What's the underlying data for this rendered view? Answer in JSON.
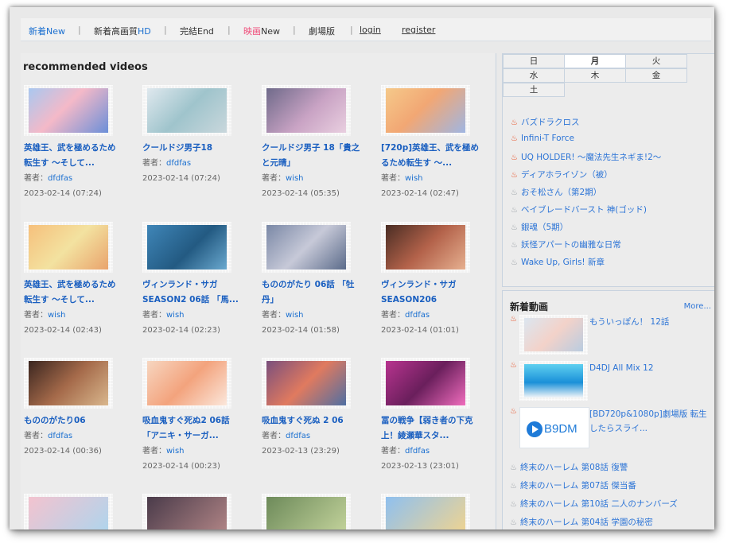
{
  "nav": {
    "items": [
      {
        "pre": "",
        "hl": "新着New",
        "post": ""
      },
      {
        "pre": "新着高画質",
        "hl": "HD",
        "post": ""
      },
      {
        "pre": "完結End",
        "hl": "",
        "post": ""
      },
      {
        "pre": "",
        "hl": "映画",
        "post": "New"
      },
      {
        "pre": "劇場版",
        "hl": "",
        "post": ""
      }
    ],
    "login": "login",
    "register": "register",
    "separator": "|"
  },
  "main": {
    "title": "recommended videos",
    "author_label": "著者：",
    "cards": [
      {
        "title1": "英雄王、武を極めるため",
        "title2": "転生す ～そして...",
        "author": "dfdfas",
        "date": "2023-02-14 (07:24)"
      },
      {
        "title1": "クールドジ男子18",
        "title2": "",
        "author": "dfdfas",
        "date": "2023-02-14 (07:24)"
      },
      {
        "title1": "クールドジ男子 18「貴之",
        "title2": "と元晴」",
        "author": "wish",
        "date": "2023-02-14 (05:35)"
      },
      {
        "title1": "[720p]英雄王、武を極め",
        "title2": "るため転生す ～...",
        "author": "wish",
        "date": "2023-02-14 (02:47)"
      },
      {
        "title1": "英雄王、武を極めるため",
        "title2": "転生す ～そして...",
        "author": "wish",
        "date": "2023-02-14 (02:43)"
      },
      {
        "title1": "ヴィンランド・サガ",
        "title2": "SEASON2 06話 「馬...",
        "author": "wish",
        "date": "2023-02-14 (02:23)"
      },
      {
        "title1": "もののがたり 06話 「牡",
        "title2": "丹」",
        "author": "wish",
        "date": "2023-02-14 (01:58)"
      },
      {
        "title1": "ヴィンランド・サガ",
        "title2": "SEASON206",
        "author": "dfdfas",
        "date": "2023-02-14 (01:01)"
      },
      {
        "title1": "もののがたり06",
        "title2": "",
        "author": "dfdfas",
        "date": "2023-02-14 (00:36)"
      },
      {
        "title1": "吸血鬼すぐ死ぬ2 06話",
        "title2": "「アニキ・サーガ...",
        "author": "wish",
        "date": "2023-02-14 (00:23)"
      },
      {
        "title1": "吸血鬼すぐ死ぬ 2 06",
        "title2": "",
        "author": "dfdfas",
        "date": "2023-02-13 (23:29)"
      },
      {
        "title1": "冨の戦争【弱き者の下克",
        "title2": "上！綾瀬華スタ...",
        "author": "dfdfas",
        "date": "2023-02-13 (23:01)"
      }
    ]
  },
  "sidebar": {
    "days": [
      "日",
      "月",
      "火",
      "水",
      "木",
      "金",
      "土"
    ],
    "active_day": "月",
    "ranking": [
      {
        "label": "バズドラクロス",
        "hot": true
      },
      {
        "label": "Infini-T Force",
        "hot": true
      },
      {
        "label": "UQ HOLDER! ～魔法先生ネギま!2～",
        "hot": true
      },
      {
        "label": "ディアホライゾン（被）",
        "hot": true
      },
      {
        "label": "おそ松さん（第2期）",
        "hot": false
      },
      {
        "label": "ベイブレードバースト 神(ゴッド)",
        "hot": false
      },
      {
        "label": "銀魂（5期）",
        "hot": false
      },
      {
        "label": "妖怪アパートの幽雅な日常",
        "hot": false
      },
      {
        "label": "Wake Up, Girls! 新章",
        "hot": false
      }
    ],
    "new_videos": {
      "heading": "新着動画",
      "more": "More...",
      "featured": [
        {
          "title": "もういっぽん！ 12話"
        },
        {
          "title": "D4DJ All Mix 12"
        },
        {
          "title": "[BD720p&1080p]劇場版 転生したらスライ..."
        }
      ],
      "logo_text": "B9DM",
      "list": [
        "終末のハーレム 第08話 復讐",
        "終末のハーレム 第07話 傑当番",
        "終末のハーレム 第10話 二人のナンバーズ",
        "終末のハーレム 第04話 学園の秘密"
      ]
    }
  },
  "colors": {
    "link": "#1a6fd0",
    "accent_pink": "#ef4d7a",
    "hot": "#e84a1f"
  }
}
